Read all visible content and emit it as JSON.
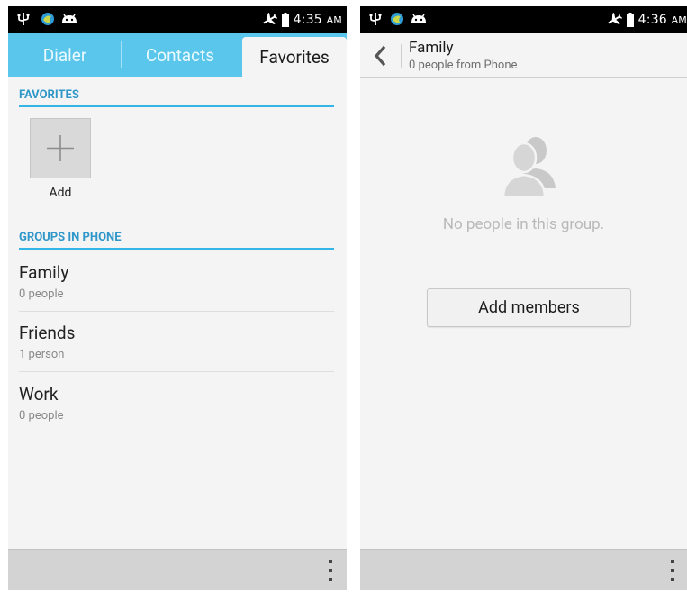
{
  "left": {
    "status": {
      "time": "4:35",
      "ampm": "AM"
    },
    "tabs": {
      "dialer": "Dialer",
      "contacts": "Contacts",
      "favorites": "Favorites"
    },
    "favorites": {
      "header": "FAVORITES",
      "add_label": "Add"
    },
    "groups": {
      "header": "GROUPS IN PHONE",
      "items": [
        {
          "name": "Family",
          "count": "0 people"
        },
        {
          "name": "Friends",
          "count": "1 person"
        },
        {
          "name": "Work",
          "count": "0 people"
        }
      ]
    }
  },
  "right": {
    "status": {
      "time": "4:36",
      "ampm": "AM"
    },
    "actionbar": {
      "title": "Family",
      "subtitle": "0 people from Phone"
    },
    "empty": {
      "message": "No people in this group."
    },
    "add_members_label": "Add members"
  },
  "colors": {
    "accent": "#33b5e5",
    "tabbar": "#5ac6ec",
    "bottom_bar": "#d3d3d3"
  }
}
